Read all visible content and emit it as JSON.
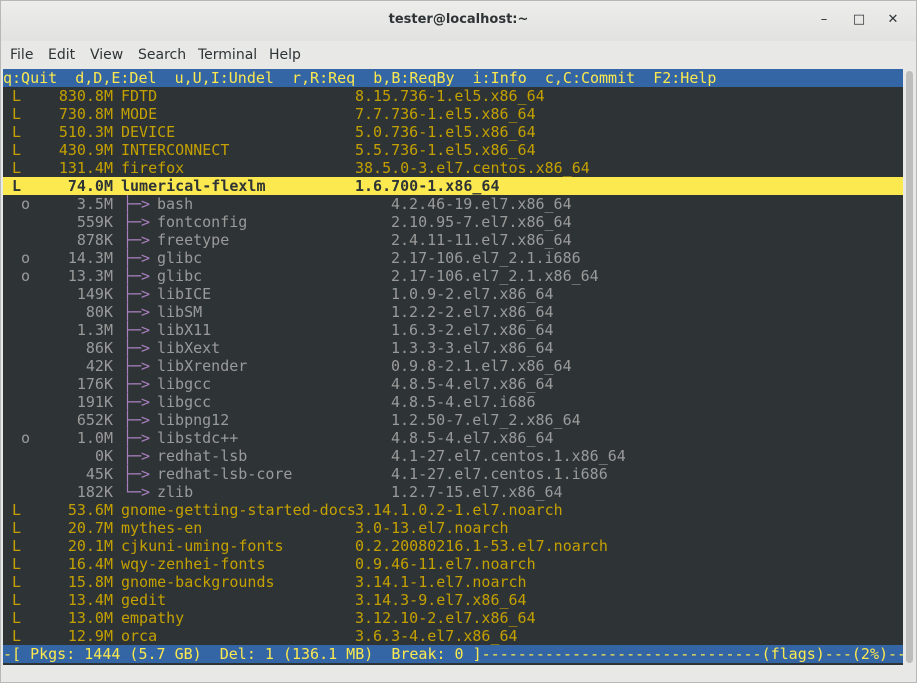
{
  "window": {
    "title": "tester@localhost:~",
    "minimize_glyph": "–",
    "maximize_glyph": "□",
    "close_glyph": "✕"
  },
  "menu": [
    "File",
    "Edit",
    "View",
    "Search",
    "Terminal",
    "Help"
  ],
  "header_line": "q:Quit  d,D,E:Del  u,U,I:Undel  r,R:Req  b,B:ReqBy  i:Info  c,C:Commit  F2:Help",
  "packages": [
    {
      "flag": "L",
      "size": "830.8M",
      "name": "FDTD",
      "version": "8.15.736-1.el5.x86_64",
      "style": "gold",
      "tree": ""
    },
    {
      "flag": "L",
      "size": "730.8M",
      "name": "MODE",
      "version": "7.7.736-1.el5.x86_64",
      "style": "gold",
      "tree": ""
    },
    {
      "flag": "L",
      "size": "510.3M",
      "name": "DEVICE",
      "version": "5.0.736-1.el5.x86_64",
      "style": "gold",
      "tree": ""
    },
    {
      "flag": "L",
      "size": "430.9M",
      "name": "INTERCONNECT",
      "version": "5.5.736-1.el5.x86_64",
      "style": "gold",
      "tree": ""
    },
    {
      "flag": "L",
      "size": "131.4M",
      "name": "firefox",
      "version": "38.5.0-3.el7.centos.x86_64",
      "style": "gold",
      "tree": ""
    },
    {
      "flag": "L",
      "size": "74.0M",
      "name": "lumerical-flexlm",
      "version": "1.6.700-1.x86_64",
      "style": "highlight",
      "tree": ""
    },
    {
      "flag": "o",
      "size": "3.5M",
      "name": "bash",
      "version": "4.2.46-19.el7.x86_64",
      "style": "dep",
      "tree": "├─>"
    },
    {
      "flag": "",
      "size": "559K",
      "name": "fontconfig",
      "version": "2.10.95-7.el7.x86_64",
      "style": "dep",
      "tree": "├─>"
    },
    {
      "flag": "",
      "size": "878K",
      "name": "freetype",
      "version": "2.4.11-11.el7.x86_64",
      "style": "dep",
      "tree": "├─>"
    },
    {
      "flag": "o",
      "size": "14.3M",
      "name": "glibc",
      "version": "2.17-106.el7_2.1.i686",
      "style": "dep",
      "tree": "├─>"
    },
    {
      "flag": "o",
      "size": "13.3M",
      "name": "glibc",
      "version": "2.17-106.el7_2.1.x86_64",
      "style": "dep",
      "tree": "├─>"
    },
    {
      "flag": "",
      "size": "149K",
      "name": "libICE",
      "version": "1.0.9-2.el7.x86_64",
      "style": "dep",
      "tree": "├─>"
    },
    {
      "flag": "",
      "size": "80K",
      "name": "libSM",
      "version": "1.2.2-2.el7.x86_64",
      "style": "dep",
      "tree": "├─>"
    },
    {
      "flag": "",
      "size": "1.3M",
      "name": "libX11",
      "version": "1.6.3-2.el7.x86_64",
      "style": "dep",
      "tree": "├─>"
    },
    {
      "flag": "",
      "size": "86K",
      "name": "libXext",
      "version": "1.3.3-3.el7.x86_64",
      "style": "dep",
      "tree": "├─>"
    },
    {
      "flag": "",
      "size": "42K",
      "name": "libXrender",
      "version": "0.9.8-2.1.el7.x86_64",
      "style": "dep",
      "tree": "├─>"
    },
    {
      "flag": "",
      "size": "176K",
      "name": "libgcc",
      "version": "4.8.5-4.el7.x86_64",
      "style": "dep",
      "tree": "├─>"
    },
    {
      "flag": "",
      "size": "191K",
      "name": "libgcc",
      "version": "4.8.5-4.el7.i686",
      "style": "dep",
      "tree": "├─>"
    },
    {
      "flag": "",
      "size": "652K",
      "name": "libpng12",
      "version": "1.2.50-7.el7_2.x86_64",
      "style": "dep",
      "tree": "├─>"
    },
    {
      "flag": "o",
      "size": "1.0M",
      "name": "libstdc++",
      "version": "4.8.5-4.el7.x86_64",
      "style": "dep",
      "tree": "├─>"
    },
    {
      "flag": "",
      "size": "0K",
      "name": "redhat-lsb",
      "version": "4.1-27.el7.centos.1.x86_64",
      "style": "dep",
      "tree": "├─>"
    },
    {
      "flag": "",
      "size": "45K",
      "name": "redhat-lsb-core",
      "version": "4.1-27.el7.centos.1.i686",
      "style": "dep",
      "tree": "├─>"
    },
    {
      "flag": "",
      "size": "182K",
      "name": "zlib",
      "version": "1.2.7-15.el7.x86_64",
      "style": "dep",
      "tree": "└─>"
    },
    {
      "flag": "L",
      "size": "53.6M",
      "name": "gnome-getting-started-docs",
      "version": "3.14.1.0.2-1.el7.noarch",
      "style": "gold",
      "tree": ""
    },
    {
      "flag": "L",
      "size": "20.7M",
      "name": "mythes-en",
      "version": "3.0-13.el7.noarch",
      "style": "gold",
      "tree": ""
    },
    {
      "flag": "L",
      "size": "20.1M",
      "name": "cjkuni-uming-fonts",
      "version": "0.2.20080216.1-53.el7.noarch",
      "style": "gold",
      "tree": ""
    },
    {
      "flag": "L",
      "size": "16.4M",
      "name": "wqy-zenhei-fonts",
      "version": "0.9.46-11.el7.noarch",
      "style": "gold",
      "tree": ""
    },
    {
      "flag": "L",
      "size": "15.8M",
      "name": "gnome-backgrounds",
      "version": "3.14.1-1.el7.noarch",
      "style": "gold",
      "tree": ""
    },
    {
      "flag": "L",
      "size": "13.4M",
      "name": "gedit",
      "version": "3.14.3-9.el7.x86_64",
      "style": "gold",
      "tree": ""
    },
    {
      "flag": "L",
      "size": "13.0M",
      "name": "empathy",
      "version": "3.12.10-2.el7.x86_64",
      "style": "gold",
      "tree": ""
    },
    {
      "flag": "L",
      "size": "12.9M",
      "name": "orca",
      "version": "3.6.3-4.el7.x86_64",
      "style": "gold",
      "tree": ""
    }
  ],
  "status_line": "-[ Pkgs: 1444 (5.7 GB)  Del: 1 (136.1 MB)  Break: 0 ]-------------------------------(flags)---(2%)--"
}
